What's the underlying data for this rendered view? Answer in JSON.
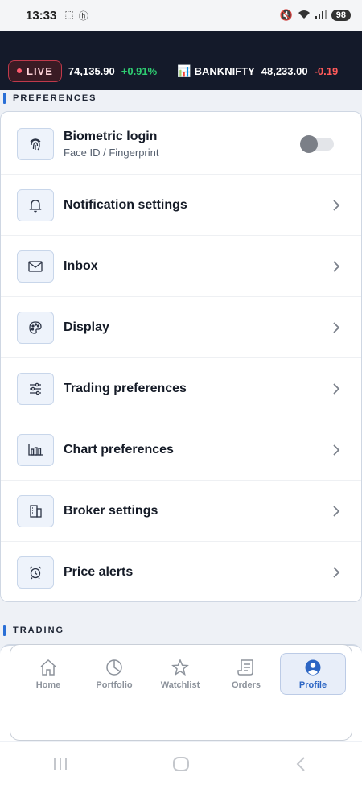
{
  "status_bar": {
    "time": "13:33",
    "battery": "98"
  },
  "ticker": {
    "live_label": "LIVE",
    "items": [
      {
        "value": "74,135.90",
        "change": "+0.91%"
      },
      {
        "name": "BANKNIFTY",
        "value": "48,233.00",
        "change": "-0.19"
      }
    ]
  },
  "sections": {
    "preferences": "PREFERENCES",
    "trading": "TRADING"
  },
  "preferences": {
    "items": [
      {
        "title": "Biometric login",
        "subtitle": "Face ID / Fingerprint",
        "icon": "fingerprint-icon",
        "toggle_on": false
      },
      {
        "title": "Notification settings",
        "icon": "bell-icon"
      },
      {
        "title": "Inbox",
        "icon": "envelope-icon"
      },
      {
        "title": "Display",
        "icon": "palette-icon"
      },
      {
        "title": "Trading preferences",
        "icon": "sliders-icon"
      },
      {
        "title": "Chart preferences",
        "icon": "bar-chart-icon"
      },
      {
        "title": "Broker settings",
        "icon": "building-icon"
      },
      {
        "title": "Price alerts",
        "icon": "alarm-clock-icon"
      }
    ]
  },
  "bottom_nav": {
    "items": [
      {
        "label": "Home",
        "icon": "home-icon"
      },
      {
        "label": "Portfolio",
        "icon": "pie-chart-icon"
      },
      {
        "label": "Watchlist",
        "icon": "star-icon"
      },
      {
        "label": "Orders",
        "icon": "receipt-icon"
      },
      {
        "label": "Profile",
        "icon": "user-icon",
        "active": true
      }
    ]
  },
  "colors": {
    "accent": "#2d66c4",
    "header_bg": "#141a2a",
    "positive": "#2ecc71",
    "negative": "#ff5a5a",
    "live_border": "#c0394b"
  }
}
